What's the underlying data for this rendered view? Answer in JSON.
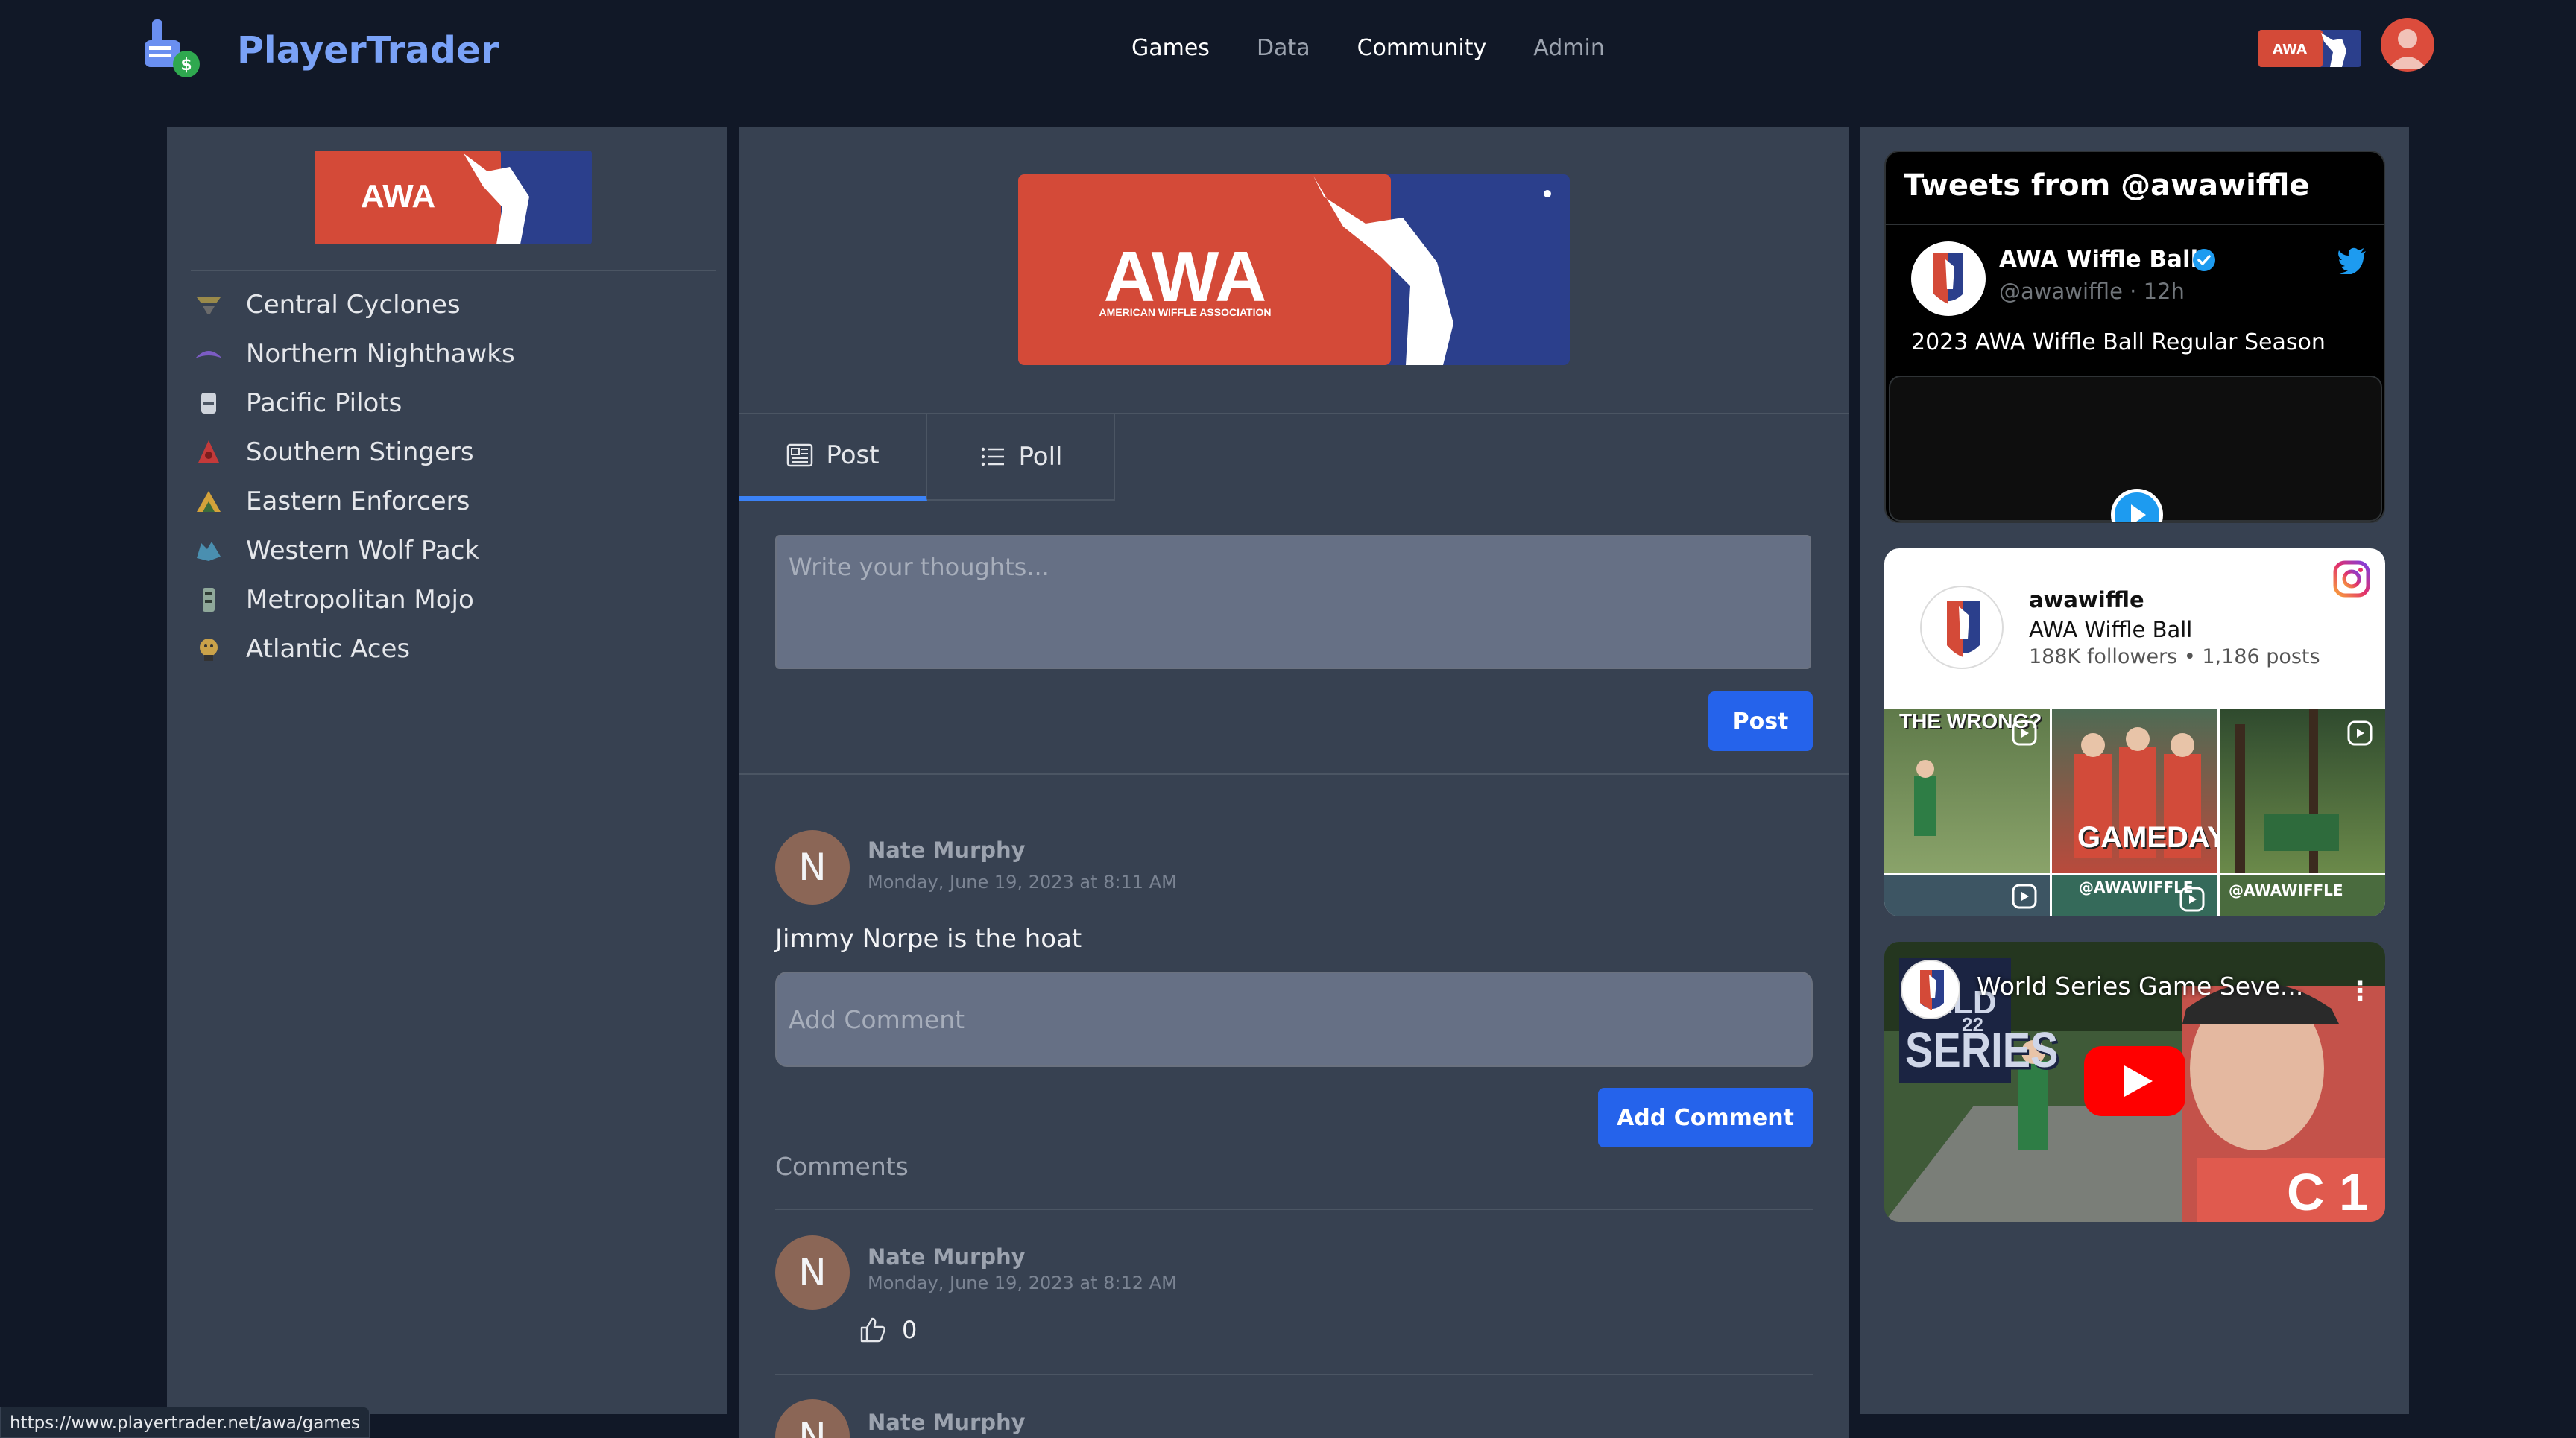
{
  "app": {
    "brand": "PlayerTrader"
  },
  "nav": {
    "items": [
      {
        "label": "Games",
        "active": true
      },
      {
        "label": "Data",
        "active": false
      },
      {
        "label": "Community",
        "active": true
      },
      {
        "label": "Admin",
        "active": false
      }
    ]
  },
  "league": {
    "logo_text": "AWA",
    "logo_subtext": "AMERICAN WIFFLE ASSOCIATION"
  },
  "sidebar": {
    "teams": [
      {
        "label": "Central Cyclones",
        "icon": "cyclone-team-icon"
      },
      {
        "label": "Northern Nighthawks",
        "icon": "nighthawk-team-icon"
      },
      {
        "label": "Pacific Pilots",
        "icon": "pilot-team-icon"
      },
      {
        "label": "Southern Stingers",
        "icon": "stinger-team-icon"
      },
      {
        "label": "Eastern Enforcers",
        "icon": "enforcer-team-icon"
      },
      {
        "label": "Western Wolf Pack",
        "icon": "wolf-team-icon"
      },
      {
        "label": "Metropolitan Mojo",
        "icon": "mojo-team-icon"
      },
      {
        "label": "Atlantic Aces",
        "icon": "aces-team-icon"
      }
    ]
  },
  "composer": {
    "tabs": [
      {
        "label": "Post",
        "icon": "newspaper-icon",
        "active": true
      },
      {
        "label": "Poll",
        "icon": "list-icon",
        "active": false
      }
    ],
    "placeholder": "Write your thoughts...",
    "submit_label": "Post"
  },
  "post": {
    "avatar_letter": "N",
    "author": "Nate Murphy",
    "timestamp": "Monday, June 19, 2023 at 8:11 AM",
    "body": "Jimmy Norpe is the hoat",
    "comment_placeholder": "Add Comment",
    "comment_button": "Add Comment",
    "comments_header": "Comments"
  },
  "comments": [
    {
      "avatar_letter": "N",
      "author": "Nate Murphy",
      "timestamp": "Monday, June 19, 2023 at 8:12 AM",
      "likes": "0"
    },
    {
      "avatar_letter": "N",
      "author": "Nate Murphy"
    }
  ],
  "twitter": {
    "title": "Tweets from @awawiffle",
    "name": "AWA Wiffle Ball",
    "handle": "@awawiffle · 12h",
    "text": "2023 AWA Wiffle Ball Regular Season"
  },
  "instagram": {
    "username": "awawiffle",
    "name": "AWA Wiffle Ball",
    "stats": "188K followers • 1,186 posts",
    "tile_texts": [
      "THE WRONG?",
      "GAMEDAY",
      "@AWAWIFFLE",
      "@AWAWIFFLE"
    ]
  },
  "youtube": {
    "title": "World Series Game Seve...",
    "thumb_text": "SERIES"
  },
  "status_bar": {
    "url": "https://www.playertrader.net/awa/games"
  },
  "colors": {
    "background": "#111827",
    "panel": "#374151",
    "accent_blue": "#2563eb",
    "brand": "#7aa2f7",
    "awa_red": "#d44a38",
    "awa_blue": "#2b3f8c"
  }
}
